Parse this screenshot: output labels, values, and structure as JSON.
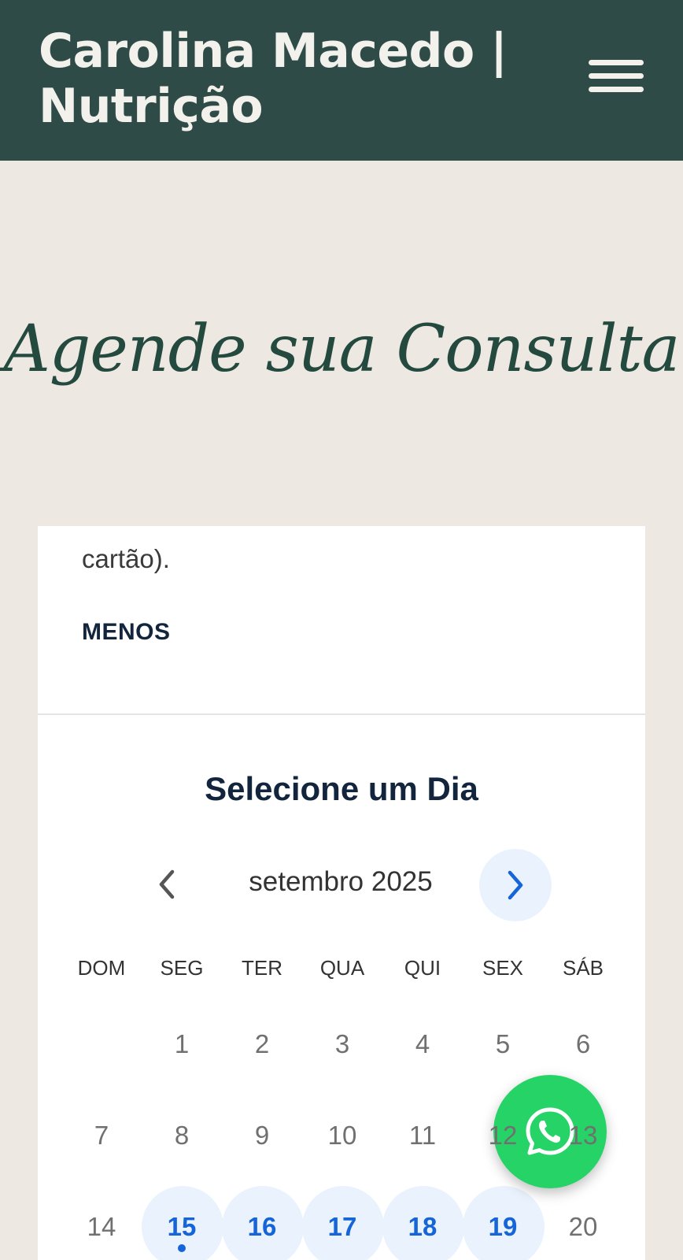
{
  "header": {
    "title": "Carolina Macedo | Nutrição",
    "menu_icon": "hamburger-menu-icon"
  },
  "hero": {
    "heading": "Agende sua Consulta"
  },
  "service": {
    "description_tail": "cartão).",
    "less_label": "MENOS"
  },
  "calendar": {
    "title": "Selecione um Dia",
    "month_label": "setembro 2025",
    "prev_icon": "chevron-left-icon",
    "next_icon": "chevron-right-icon",
    "weekdays": [
      "DOM",
      "SEG",
      "TER",
      "QUA",
      "QUI",
      "SEX",
      "SÁB"
    ],
    "weeks": [
      [
        {
          "day": ""
        },
        {
          "day": "1"
        },
        {
          "day": "2"
        },
        {
          "day": "3"
        },
        {
          "day": "4"
        },
        {
          "day": "5"
        },
        {
          "day": "6"
        }
      ],
      [
        {
          "day": "7"
        },
        {
          "day": "8"
        },
        {
          "day": "9"
        },
        {
          "day": "10"
        },
        {
          "day": "11"
        },
        {
          "day": "12"
        },
        {
          "day": "13"
        }
      ],
      [
        {
          "day": "14"
        },
        {
          "day": "15",
          "available": true,
          "today": true
        },
        {
          "day": "16",
          "available": true
        },
        {
          "day": "17",
          "available": true
        },
        {
          "day": "18",
          "available": true
        },
        {
          "day": "19",
          "available": true
        },
        {
          "day": "20"
        }
      ]
    ]
  },
  "whatsapp": {
    "icon": "whatsapp-icon",
    "color": "#25d366"
  },
  "colors": {
    "header_bg": "#2e4b48",
    "page_bg": "#ede8e1",
    "accent": "#1565d8",
    "heading": "#244a40"
  }
}
